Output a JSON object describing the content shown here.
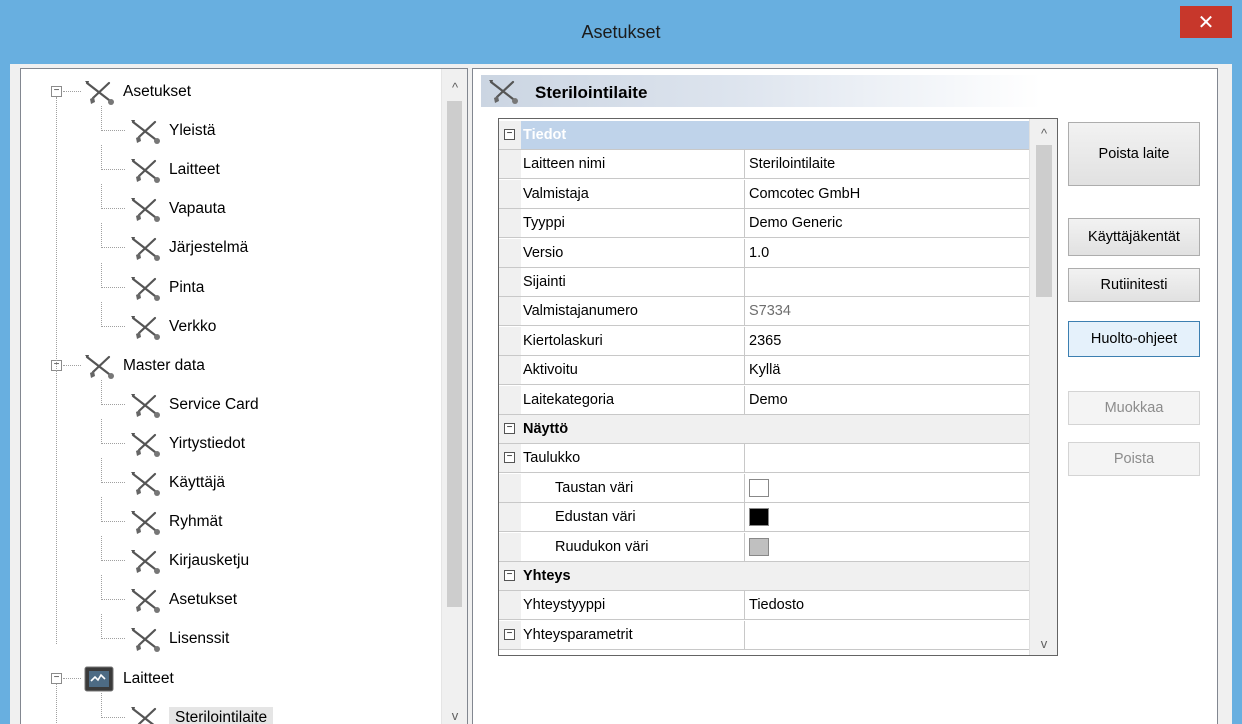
{
  "window": {
    "title": "Asetukset",
    "close_glyph": "✕"
  },
  "tree": {
    "items": [
      {
        "label": "Asetukset",
        "level": 0,
        "icon": "tools-icon",
        "expander": "−"
      },
      {
        "label": "Yleistä",
        "level": 1,
        "icon": "tools-icon"
      },
      {
        "label": "Laitteet",
        "level": 1,
        "icon": "tools-icon"
      },
      {
        "label": "Vapauta",
        "level": 1,
        "icon": "tools-icon"
      },
      {
        "label": "Järjestelmä",
        "level": 1,
        "icon": "tools-icon"
      },
      {
        "label": "Pinta",
        "level": 1,
        "icon": "tools-icon"
      },
      {
        "label": "Verkko",
        "level": 1,
        "icon": "tools-icon"
      },
      {
        "label": "Master data",
        "level": 0,
        "icon": "tools-icon",
        "expander": "−"
      },
      {
        "label": "Service Card",
        "level": 1,
        "icon": "tools-icon"
      },
      {
        "label": "Yirtystiedot",
        "level": 1,
        "icon": "tools-icon"
      },
      {
        "label": "Käyttäjä",
        "level": 1,
        "icon": "tools-icon"
      },
      {
        "label": "Ryhmät",
        "level": 1,
        "icon": "tools-icon"
      },
      {
        "label": "Kirjausketju",
        "level": 1,
        "icon": "tools-icon"
      },
      {
        "label": "Asetukset",
        "level": 1,
        "icon": "tools-icon"
      },
      {
        "label": "Lisenssit",
        "level": 1,
        "icon": "tools-icon"
      },
      {
        "label": "Laitteet",
        "level": 0,
        "icon": "device-monitor-icon",
        "expander": "−"
      },
      {
        "label": "Sterilointilaite",
        "level": 1,
        "icon": "tools-icon",
        "selected": true
      }
    ],
    "scroll_up": "^",
    "scroll_down": "v"
  },
  "detail": {
    "header_title": "Sterilointilaite",
    "grid": {
      "rows": [
        {
          "kind": "category",
          "name": "Tiedot",
          "selected": true,
          "expander": "−"
        },
        {
          "kind": "prop",
          "name": "Laitteen nimi",
          "value": "Sterilointilaite"
        },
        {
          "kind": "prop",
          "name": "Valmistaja",
          "value": "Comcotec GmbH"
        },
        {
          "kind": "prop",
          "name": "Tyyppi",
          "value": "Demo Generic"
        },
        {
          "kind": "prop",
          "name": "Versio",
          "value": "1.0"
        },
        {
          "kind": "prop",
          "name": "Sijainti",
          "value": ""
        },
        {
          "kind": "prop",
          "name": "Valmistajanumero",
          "value": "S7334",
          "readonly": true
        },
        {
          "kind": "prop",
          "name": "Kiertolaskuri",
          "value": "2365"
        },
        {
          "kind": "prop",
          "name": "Aktivoitu",
          "value": "Kyllä"
        },
        {
          "kind": "prop",
          "name": "Laitekategoria",
          "value": "Demo"
        },
        {
          "kind": "category",
          "name": "Näyttö",
          "expander": "−"
        },
        {
          "kind": "subgroup",
          "name": "Taulukko",
          "value": "",
          "expander": "−"
        },
        {
          "kind": "color",
          "name": "Taustan väri",
          "color": "#ffffff"
        },
        {
          "kind": "color",
          "name": "Edustan väri",
          "color": "#000000"
        },
        {
          "kind": "color",
          "name": "Ruudukon väri",
          "color": "#c0c0c0"
        },
        {
          "kind": "category",
          "name": "Yhteys",
          "expander": "−"
        },
        {
          "kind": "prop",
          "name": "Yhteystyyppi",
          "value": "Tiedosto"
        },
        {
          "kind": "subgroup",
          "name": "Yhteysparametrit",
          "value": "",
          "expander": "−"
        }
      ]
    },
    "buttons": {
      "remove_device": "Poista laite",
      "user_fields": "Käyttäjäkentät",
      "routine_test": "Rutiinitesti",
      "maintenance": "Huolto-ohjeet",
      "edit": "Muokkaa",
      "delete": "Poista"
    }
  },
  "colors": {
    "titlebar": "#68afe0",
    "close": "#c7372b",
    "selection_category": "#bfd3ea",
    "focus_border": "#3c7fb1"
  }
}
